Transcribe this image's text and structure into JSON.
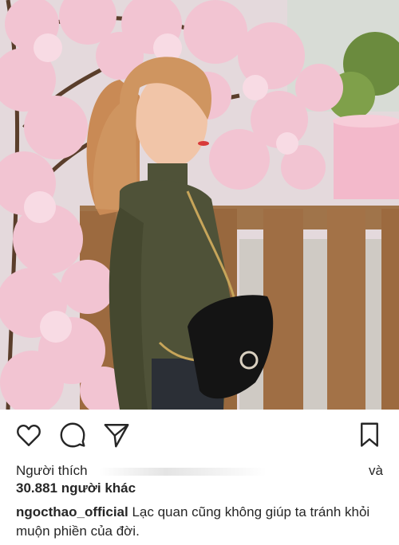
{
  "post": {
    "photo_alt": "photo",
    "liked_by_prefix": "Người thích",
    "liked_by_and": "và",
    "likes_count_text": "30.881 người khác",
    "username": "ngocthao_official",
    "caption": "Lạc quan cũng không giúp ta tránh khỏi muộn phiền của đời."
  },
  "icons": {
    "like": "heart-icon",
    "comment": "comment-bubble-icon",
    "share": "send-paper-plane-icon",
    "save": "bookmark-icon"
  },
  "colors": {
    "text": "#262626",
    "blossom": "#f2c4d2",
    "fence": "#9c6a3f",
    "sweater": "#4f5238",
    "bag": "#141414"
  }
}
